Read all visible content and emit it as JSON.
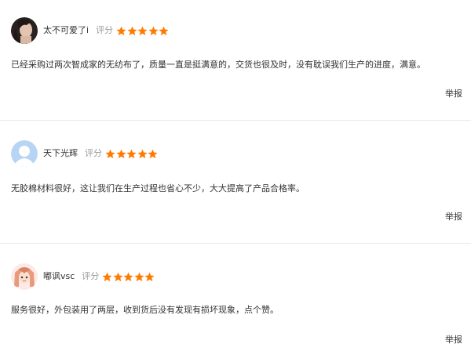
{
  "rating_label": "评分",
  "star_color": "#ff7a00",
  "report_label": "举报",
  "reviews": [
    {
      "username": "太不可爱了i",
      "stars": 5,
      "avatar_icon": "dark-hair-portrait-avatar",
      "content": "已经采购过两次智成家的无纺布了，质量一直是挺满意的，交货也很及时，没有耽误我们生产的进度，满意。"
    },
    {
      "username": "天下光辉",
      "stars": 5,
      "avatar_icon": "default-user-avatar",
      "content": "无胶棉材料很好，这让我们在生产过程也省心不少，大大提高了产品合格率。"
    },
    {
      "username": "嘟讽vsc",
      "stars": 5,
      "avatar_icon": "anime-girl-avatar",
      "content": "服务很好，外包装用了两层，收到货后没有发现有损坏现象，点个赞。"
    }
  ]
}
